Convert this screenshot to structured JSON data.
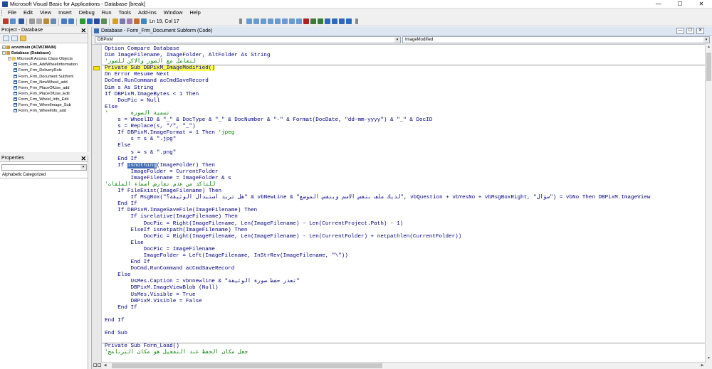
{
  "window": {
    "title": "Microsoft Visual Basic for Applications - Database [break]",
    "controls": {
      "minimize": "—",
      "maximize": "☐",
      "close": "✕"
    }
  },
  "menu": [
    "File",
    "Edit",
    "View",
    "Insert",
    "Debug",
    "Run",
    "Tools",
    "Add-Ins",
    "Window",
    "Help"
  ],
  "toolbar": {
    "position": "Ln 19, Col 17"
  },
  "project_pane": {
    "title": "Project - Database",
    "close": "✕",
    "tree": [
      {
        "label": "acwzmain (ACWZMAIN)",
        "indent": 0,
        "expander": "+",
        "icon": "db",
        "bold": true
      },
      {
        "label": "Database (Database)",
        "indent": 0,
        "expander": "−",
        "icon": "db",
        "bold": true
      },
      {
        "label": "Microsoft Access Class Objects",
        "indent": 1,
        "expander": "−",
        "icon": "folder",
        "bold": false
      },
      {
        "label": "Form_Frm_AddWheelInformation",
        "indent": 2,
        "icon": "form"
      },
      {
        "label": "Form_Frm_DeliveryRole",
        "indent": 2,
        "icon": "form"
      },
      {
        "label": "Form_Frm_Document Subform",
        "indent": 2,
        "icon": "form"
      },
      {
        "label": "Form_Frm_NewWheel_add",
        "indent": 2,
        "icon": "form"
      },
      {
        "label": "Form_Frm_PlaceOfUse_add",
        "indent": 2,
        "icon": "form"
      },
      {
        "label": "Form_Frm_PlaceOfUse_Edit",
        "indent": 2,
        "icon": "form"
      },
      {
        "label": "Form_Frm_Wheel_Info_Edit",
        "indent": 2,
        "icon": "form"
      },
      {
        "label": "Form_Frm_WheelImage_Sub",
        "indent": 2,
        "icon": "form"
      },
      {
        "label": "Form_Frm_WheelInfo_add",
        "indent": 2,
        "icon": "form"
      }
    ]
  },
  "properties_pane": {
    "title": "Properties",
    "close": "✕",
    "tabs": [
      "Alphabetic",
      "Categorized"
    ]
  },
  "code_window": {
    "title": "Database - Form_Frm_Document Subform (Code)",
    "object_combo": "DBPixM",
    "proc_combo": "ImageModified",
    "lines": [
      [
        [
          "Option Compare Database",
          ""
        ]
      ],
      [
        [
          "Dim ImageFilename, ImageFolder, AltFolder As String",
          ""
        ]
      ],
      [
        [
          "'لتعامل مع الصور والاكن للصور",
          "cm"
        ]
      ],
      [
        [
          "Private Sub DBPixM_ImageModified()",
          "hl"
        ]
      ],
      [
        [
          "On Error Resume Next",
          ""
        ]
      ],
      [
        [
          "DoCmd.RunCommand acCmdSaveRecord",
          ""
        ]
      ],
      [
        [
          "Dim s As String",
          ""
        ]
      ],
      [
        [
          "If DBPixM.ImageBytes < 1 Then",
          ""
        ]
      ],
      [
        [
          "    DocPic = Null",
          ""
        ]
      ],
      [
        [
          "Else",
          ""
        ]
      ],
      [
        [
          "'       تسمية الصورة",
          "cm"
        ]
      ],
      [
        [
          "    s = WheelID & \"_\" & DocType & \"_\" & DocNumber & \"-\" & Format(DocDate, \"dd-mm-yyyy\") & \"_\" & DocID",
          ""
        ]
      ],
      [
        [
          "    s = Replace(s, \"/\", \"_\")",
          ""
        ]
      ],
      [
        [
          "    If DBPixM.ImageFormat = 1 Then ",
          ""
        ],
        [
          "'jpeg",
          "cm"
        ]
      ],
      [
        [
          "        s = s & \".jpg\"",
          ""
        ]
      ],
      [
        [
          "    Else",
          ""
        ]
      ],
      [
        [
          "        s = s & \".png\"",
          ""
        ]
      ],
      [
        [
          "    End If",
          ""
        ]
      ],
      [
        [
          "    If ",
          ""
        ],
        [
          "isnothing",
          "sel"
        ],
        [
          "(ImageFolder) Then",
          ""
        ]
      ],
      [
        [
          "        ImageFolder = CurrentFolder",
          ""
        ]
      ],
      [
        [
          "        ImageFilename = ImageFolder & s",
          ""
        ]
      ],
      [
        [
          "'للتاكد من عدم تعارض اسماء الملفات",
          "cm"
        ]
      ],
      [
        [
          "    If FileExist(ImageFilename) Then",
          ""
        ]
      ],
      [
        [
          "        If MsgBox(\"هل تريد استبدال الوثيقة؟\" & vbNewLine & \"لديك ملف بنفس الاسم وبنفس الموضع\", vbQuestion + vbYesNo + vbMsgBoxRight, \"سؤال\") = vbNo Then DBPixM.ImageView",
          ""
        ]
      ],
      [
        [
          "    End If",
          ""
        ]
      ],
      [
        [
          "    If DBPixM.ImageSaveFile(ImageFilename) Then",
          ""
        ]
      ],
      [
        [
          "        If isrelative(ImageFilename) Then",
          ""
        ]
      ],
      [
        [
          "            DocPic = Right(ImageFilename, Len(ImageFilename) - Len(CurrentProject.Path) - 1)",
          ""
        ]
      ],
      [
        [
          "        ElseIf isnetpath(ImageFilename) Then",
          ""
        ]
      ],
      [
        [
          "            DocPic = Right(ImageFilename, Len(ImageFilename) - Len(CurrentFolder) + netpathlen(CurrentFolder))",
          ""
        ]
      ],
      [
        [
          "        Else",
          ""
        ]
      ],
      [
        [
          "            DocPic = ImageFilename",
          ""
        ]
      ],
      [
        [
          "            ImageFolder = Left(ImageFilename, InStrRev(ImageFilename, \"\\\"))",
          ""
        ]
      ],
      [
        [
          "        End If",
          ""
        ]
      ],
      [
        [
          "        DoCmd.RunCommand acCmdSaveRecord",
          ""
        ]
      ],
      [
        [
          "    Else",
          ""
        ]
      ],
      [
        [
          "        UsMes.Caption = vbnnewline & \"تعذر حفظ صورة الوثيقة\"",
          ""
        ]
      ],
      [
        [
          "        DBPixM.ImageViewBlob (Null)",
          ""
        ]
      ],
      [
        [
          "        UsMes.Visible = True",
          ""
        ]
      ],
      [
        [
          "        DBPixM.Visible = False",
          ""
        ]
      ],
      [
        [
          "    End If",
          ""
        ]
      ],
      [
        [
          "",
          ""
        ]
      ],
      [
        [
          "End If",
          ""
        ]
      ],
      [
        [
          "",
          ""
        ]
      ],
      [
        [
          "End Sub",
          ""
        ]
      ],
      [
        [
          "",
          ""
        ]
      ],
      [
        [
          "Private Sub Form_Load()",
          ""
        ]
      ],
      [
        [
          "'جعل مكان الحفظ عند التفعيل هو مكان البرنامج",
          "cm"
        ]
      ]
    ]
  },
  "colors": {
    "code": "#00007f",
    "comment": "#008000",
    "exec_highlight": "#ffff5c",
    "selection": "#3e6db5"
  }
}
